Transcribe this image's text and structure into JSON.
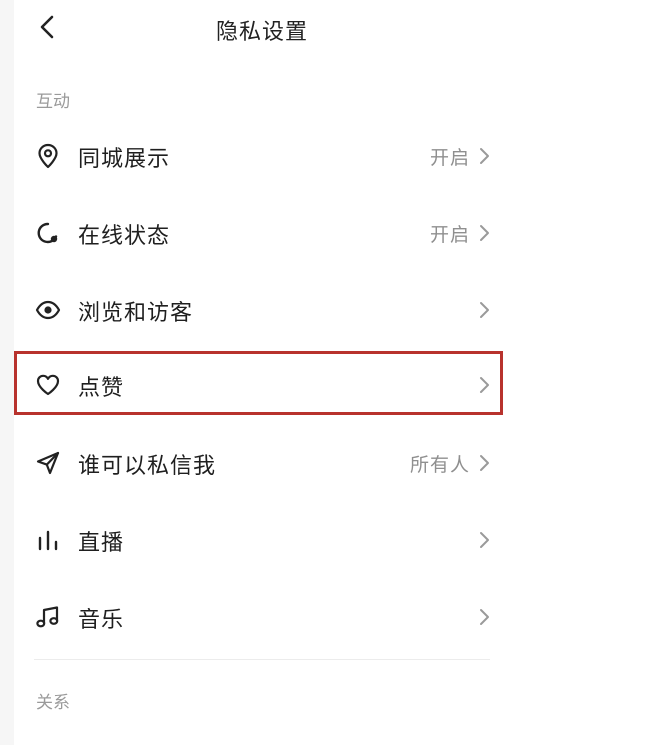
{
  "header": {
    "title": "隐私设置"
  },
  "sections": [
    {
      "label": "互动",
      "items": [
        {
          "label": "同城展示",
          "value": "开启",
          "icon": "location-pin-icon"
        },
        {
          "label": "在线状态",
          "value": "开启",
          "icon": "online-status-icon"
        },
        {
          "label": "浏览和访客",
          "value": "",
          "icon": "eye-icon"
        },
        {
          "label": "点赞",
          "value": "",
          "icon": "heart-icon"
        },
        {
          "label": "谁可以私信我",
          "value": "所有人",
          "icon": "send-icon"
        },
        {
          "label": "直播",
          "value": "",
          "icon": "live-bars-icon"
        },
        {
          "label": "音乐",
          "value": "",
          "icon": "music-note-icon"
        }
      ]
    },
    {
      "label": "关系"
    }
  ],
  "colors": {
    "highlight": "#b8322d",
    "text": "#1f1f1f",
    "muted": "#8f8f8f"
  }
}
